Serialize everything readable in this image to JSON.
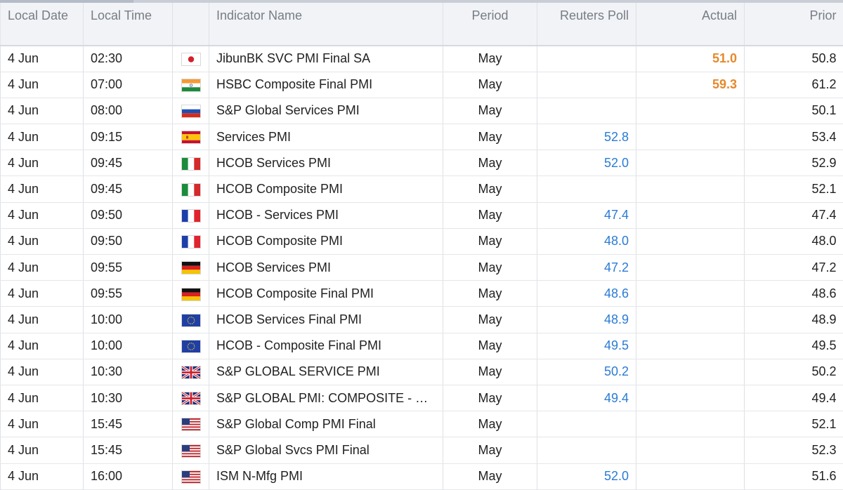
{
  "columns": {
    "date": "Local Date",
    "time": "Local Time",
    "flag": "",
    "name": "Indicator Name",
    "period": "Period",
    "poll": "Reuters Poll",
    "actual": "Actual",
    "prior": "Prior"
  },
  "rows": [
    {
      "date": "4 Jun",
      "time": "02:30",
      "flag": "japan-flag-icon",
      "name": "JibunBK SVC PMI Final SA",
      "period": "May",
      "poll": "",
      "actual": "51.0",
      "prior": "50.8"
    },
    {
      "date": "4 Jun",
      "time": "07:00",
      "flag": "india-flag-icon",
      "name": "HSBC Composite Final PMI",
      "period": "May",
      "poll": "",
      "actual": "59.3",
      "prior": "61.2"
    },
    {
      "date": "4 Jun",
      "time": "08:00",
      "flag": "russia-flag-icon",
      "name": "S&P Global Services PMI",
      "period": "May",
      "poll": "",
      "actual": "",
      "prior": "50.1"
    },
    {
      "date": "4 Jun",
      "time": "09:15",
      "flag": "spain-flag-icon",
      "name": "Services PMI",
      "period": "May",
      "poll": "52.8",
      "actual": "",
      "prior": "53.4"
    },
    {
      "date": "4 Jun",
      "time": "09:45",
      "flag": "italy-flag-icon",
      "name": "HCOB Services PMI",
      "period": "May",
      "poll": "52.0",
      "actual": "",
      "prior": "52.9"
    },
    {
      "date": "4 Jun",
      "time": "09:45",
      "flag": "italy-flag-icon",
      "name": "HCOB Composite PMI",
      "period": "May",
      "poll": "",
      "actual": "",
      "prior": "52.1"
    },
    {
      "date": "4 Jun",
      "time": "09:50",
      "flag": "france-flag-icon",
      "name": "HCOB - Services PMI",
      "period": "May",
      "poll": "47.4",
      "actual": "",
      "prior": "47.4"
    },
    {
      "date": "4 Jun",
      "time": "09:50",
      "flag": "france-flag-icon",
      "name": "HCOB Composite PMI",
      "period": "May",
      "poll": "48.0",
      "actual": "",
      "prior": "48.0"
    },
    {
      "date": "4 Jun",
      "time": "09:55",
      "flag": "germany-flag-icon",
      "name": "HCOB Services PMI",
      "period": "May",
      "poll": "47.2",
      "actual": "",
      "prior": "47.2"
    },
    {
      "date": "4 Jun",
      "time": "09:55",
      "flag": "germany-flag-icon",
      "name": "HCOB Composite Final PMI",
      "period": "May",
      "poll": "48.6",
      "actual": "",
      "prior": "48.6"
    },
    {
      "date": "4 Jun",
      "time": "10:00",
      "flag": "eu-flag-icon",
      "name": "HCOB Services Final PMI",
      "period": "May",
      "poll": "48.9",
      "actual": "",
      "prior": "48.9"
    },
    {
      "date": "4 Jun",
      "time": "10:00",
      "flag": "eu-flag-icon",
      "name": "HCOB - Composite Final PMI",
      "period": "May",
      "poll": "49.5",
      "actual": "",
      "prior": "49.5"
    },
    {
      "date": "4 Jun",
      "time": "10:30",
      "flag": "uk-flag-icon",
      "name": "S&P GLOBAL SERVICE PMI",
      "period": "May",
      "poll": "50.2",
      "actual": "",
      "prior": "50.2"
    },
    {
      "date": "4 Jun",
      "time": "10:30",
      "flag": "uk-flag-icon",
      "name": "S&P GLOBAL PMI: COMPOSITE - O...",
      "period": "May",
      "poll": "49.4",
      "actual": "",
      "prior": "49.4"
    },
    {
      "date": "4 Jun",
      "time": "15:45",
      "flag": "usa-flag-icon",
      "name": "S&P Global Comp PMI Final",
      "period": "May",
      "poll": "",
      "actual": "",
      "prior": "52.1"
    },
    {
      "date": "4 Jun",
      "time": "15:45",
      "flag": "usa-flag-icon",
      "name": "S&P Global Svcs PMI Final",
      "period": "May",
      "poll": "",
      "actual": "",
      "prior": "52.3"
    },
    {
      "date": "4 Jun",
      "time": "16:00",
      "flag": "usa-flag-icon",
      "name": "ISM N-Mfg PMI",
      "period": "May",
      "poll": "52.0",
      "actual": "",
      "prior": "51.6"
    }
  ],
  "colors": {
    "poll": "#2a7bd6",
    "actual": "#e6892a",
    "header_bg": "#f1f3f6",
    "header_text": "#777d86"
  }
}
